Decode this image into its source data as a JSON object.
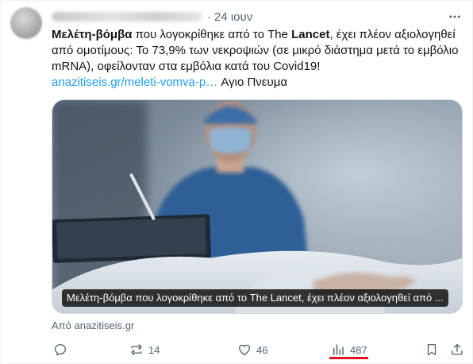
{
  "tweet": {
    "date": "24 ιουν",
    "separator": "·",
    "text": {
      "bold1": "Μελέτη-βόμβα",
      "part1": " που λογοκρίθηκε από το The ",
      "bold2": "Lancet",
      "part2": ", έχει πλέον αξιολογηθεί από ομοτίμους: Το 73,9% των νεκροψιών (σε μικρό διάστημα μετά το εμβόλιο mRNA), οφείλονταν στα εμβόλια κατά του Covid19!"
    },
    "link": "anazitiseis.gr/meleti-vomva-p…",
    "link_suffix": " Αγιο Πνευμα"
  },
  "card": {
    "caption": "Μελέτη-βόμβα που λογοκρίθηκε από το The Lancet, έχει πλέον αξιολογηθεί από ...",
    "source": "Από anazitiseis.gr"
  },
  "actions": {
    "reply_icon": "reply-icon",
    "retweet_icon": "retweet-icon",
    "retweet_count": "14",
    "like_icon": "heart-icon",
    "like_count": "46",
    "views_icon": "views-icon",
    "views_count": "487",
    "bookmark_icon": "bookmark-icon",
    "share_icon": "share-icon"
  },
  "colors": {
    "link": "#1d9bf0",
    "secondary_text": "#536471",
    "highlight_underline": "#e0141e"
  }
}
